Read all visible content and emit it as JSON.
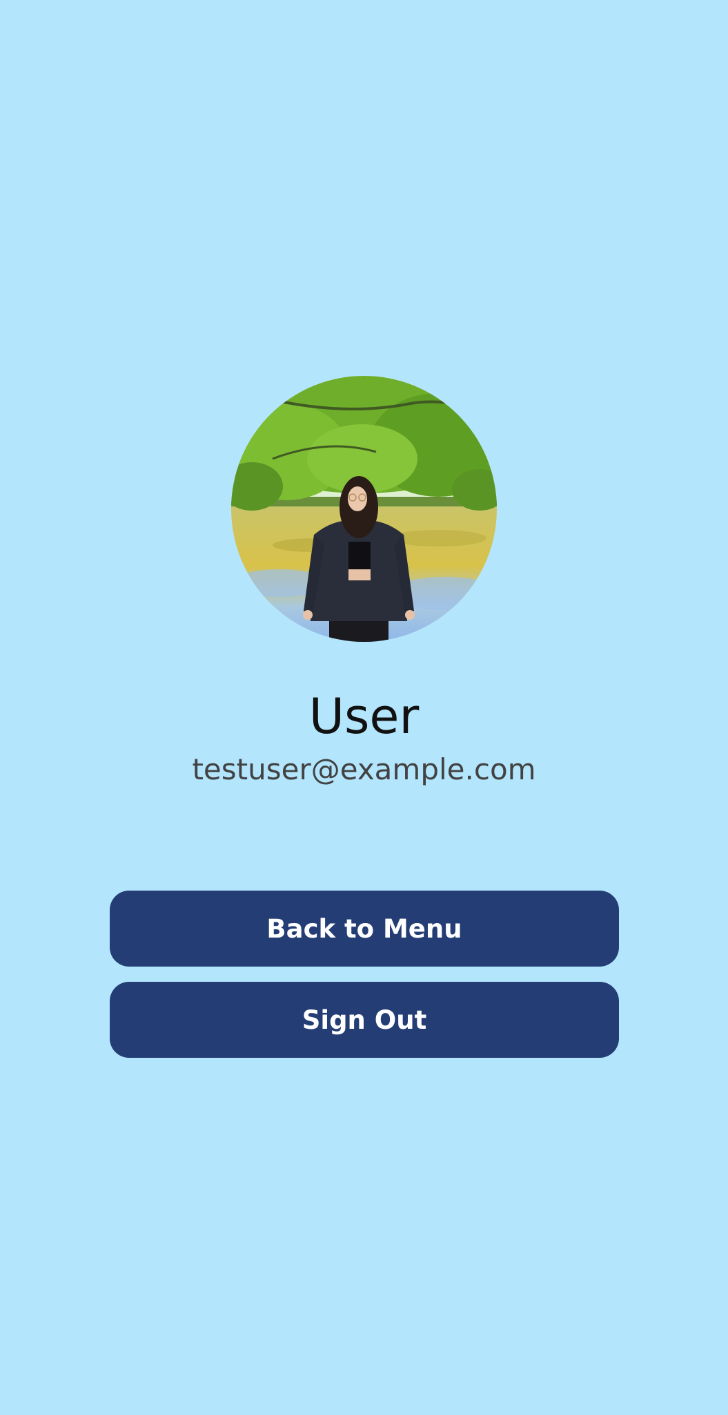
{
  "profile": {
    "avatar_icon": "profile-photo",
    "name": "User",
    "email": "testuser@example.com"
  },
  "actions": {
    "back_label": "Back to Menu",
    "signout_label": "Sign Out"
  },
  "colors": {
    "background": "#b3e5fc",
    "button": "#243e75",
    "button_text": "#ffffff",
    "name_text": "#111111",
    "email_text": "#424242"
  }
}
